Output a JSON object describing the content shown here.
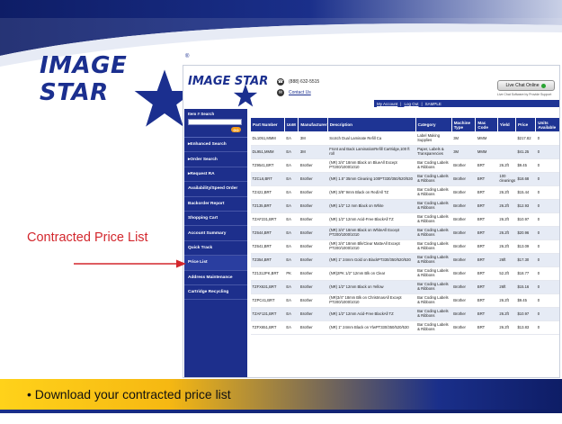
{
  "colors": {
    "brand_blue": "#1b2f8f",
    "callout_red": "#d3272d",
    "bar_gold": "#ffd21a",
    "bar_navy": "#0e1d66"
  },
  "logo": {
    "text": "IMAGE STAR",
    "tm": "®"
  },
  "site": {
    "logo_text": "IMAGE STAR",
    "phone_icon": "phone-icon",
    "phone": "(888) 632-5515",
    "contact_icon": "email-icon",
    "contact": "Contact Us",
    "live_chat": "Live Chat Online",
    "live_chat_sub": "Live Chat Software by Provide Support",
    "account_links": [
      "My Account",
      "Log Out"
    ],
    "separator": "|",
    "user": "SAMPLE"
  },
  "sidebar": {
    "search_label": "Item # Search",
    "search_value": "",
    "go_label": "GO",
    "items": [
      {
        "label": "Enhanced Search",
        "arrow": true
      },
      {
        "label": "Order Search",
        "arrow": true
      },
      {
        "label": "Request RA",
        "arrow": true
      },
      {
        "label": "Availability/Speed Order",
        "arrow": false
      },
      {
        "label": "Backorder Report",
        "arrow": false
      },
      {
        "label": "Shopping Cart",
        "arrow": false
      },
      {
        "label": "Account Summary",
        "arrow": false
      },
      {
        "label": "Quick Track",
        "arrow": false
      },
      {
        "label": "Price List",
        "arrow": false
      },
      {
        "label": "Address Maintenance",
        "arrow": false
      },
      {
        "label": "Cartridge Recycling",
        "arrow": false
      }
    ]
  },
  "table": {
    "headers": [
      "Part Number",
      "UoM",
      "Manufacturer",
      "Description",
      "Category",
      "Machine Type",
      "Mac Code",
      "Yield",
      "Price",
      "Units Available"
    ],
    "rows": [
      [
        "DL1051,MMM",
        "EA",
        "3M",
        "Scotch Dual Laminate Refill Ca",
        "Label Making Supplies",
        "3M",
        "MMM",
        "",
        "$217.82",
        "0"
      ],
      [
        "DL951,MMM",
        "EA",
        "3M",
        "Front and Back LaminationRefill Cartridge,100 ft roll",
        "Paper, Labels & Transparencies",
        "3M",
        "MMM",
        "",
        "$41.25",
        "0"
      ],
      [
        "TZ9541,BRT",
        "EA",
        "Brother",
        "(NR) 3/4\" 18mm Black on BlueAll Except PT200/1000/1010",
        "Bar Coding Labels & Ribbons",
        "Brother",
        "BRT",
        "26.2ft",
        "$9.45",
        "0"
      ],
      [
        "TZCL6,BRT",
        "EA",
        "Brother",
        "(NR) 1.5\" 35mm Cleaning 100PT330/350/520/530",
        "Bar Coding Labels & Ribbons",
        "Brother",
        "BRT",
        "100 cleanings",
        "$18.68",
        "0"
      ],
      [
        "TZ421,BRT",
        "EA",
        "Brother",
        "(NR) 3/8\" 9mm Black on Red/All TZ",
        "Bar Coding Labels & Ribbons",
        "Brother",
        "BRT",
        "26.2ft",
        "$15.44",
        "0"
      ],
      [
        "TZ135,BRT",
        "EA",
        "Brother",
        "(NR) 1/2\" 12 mm Black on White",
        "Bar Coding Labels & Ribbons",
        "Brother",
        "BRT",
        "26.2ft",
        "$12.93",
        "0"
      ],
      [
        "TZAF231,BRT",
        "EA",
        "Brother",
        "(NR) 1/2\" 12mm Acid-Free BlackAll TZ",
        "Bar Coding Labels & Ribbons",
        "Brother",
        "BRT",
        "26.2ft",
        "$10.97",
        "0"
      ],
      [
        "TZ644,BRT",
        "EA",
        "Brother",
        "(NR) 3/4\" 18mm Black on WhiteAll Except PT200/1000/1010",
        "Bar Coding Labels & Ribbons",
        "Brother",
        "BRT",
        "26.2ft",
        "$20.96",
        "0"
      ],
      [
        "TZ641,BRT",
        "EA",
        "Brother",
        "(NR) 3/4\" 18mm Blk/Clear MatteAll Except PT200/1000/1010",
        "Bar Coding Labels & Ribbons",
        "Brother",
        "BRT",
        "26.2ft",
        "$13.09",
        "0"
      ],
      [
        "TZ354,BRT",
        "EA",
        "Brother",
        "(NR) 1\" 24mm Gold on BlackPT330/350/520/530",
        "Bar Coding Labels & Ribbons",
        "Brother",
        "BRT",
        "26ft",
        "$17.30",
        "0"
      ],
      [
        "TZ1312PK,BRT",
        "PK",
        "Brother",
        "(NR)2PK 1/2\" 12mm Blk on Clear",
        "Bar Coding Labels & Ribbons",
        "Brother",
        "BRT",
        "52.2ft",
        "$18.77",
        "0"
      ],
      [
        "TZFX631,BRT",
        "EA",
        "Brother",
        "(NR) 1/2\" 12mm Black on Yellow",
        "Bar Coding Labels & Ribbons",
        "Brother",
        "BRT",
        "26ft",
        "$15.16",
        "0"
      ],
      [
        "TZPC41,BRT",
        "EA",
        "Brother",
        "(NR)3/4\" 18mm Blk on ChristmasAll Except PT200/1000/1010",
        "Bar Coding Labels & Ribbons",
        "Brother",
        "BRT",
        "26.2ft",
        "$9.45",
        "0"
      ],
      [
        "TZAF131,BRT",
        "EA",
        "Brother",
        "(NR) 1/2\" 12mm Acid-Free BlackAll TZ",
        "Bar Coding Labels & Ribbons",
        "Brother",
        "BRT",
        "26.2ft",
        "$10.97",
        "0"
      ],
      [
        "TZFX651,BRT",
        "EA",
        "Brother",
        "(NR) 1\" 24mm Black on YlwPT330/350/520/530",
        "Bar Coding Labels & Ribbons",
        "Brother",
        "BRT",
        "26.2ft",
        "$13.83",
        "0"
      ]
    ]
  },
  "callout": {
    "label": "Contracted Price List"
  },
  "footer": {
    "bullet": "• Download your contracted price list"
  }
}
